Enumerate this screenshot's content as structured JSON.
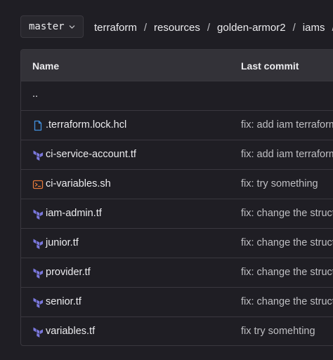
{
  "branch": {
    "label": "master"
  },
  "breadcrumb": [
    "terraform",
    "resources",
    "golden-armor2",
    "iams"
  ],
  "breadcrumb_sep": "/",
  "table": {
    "headers": {
      "name": "Name",
      "last_commit": "Last commit"
    },
    "parent": "..",
    "rows": [
      {
        "name": ".terraform.lock.hcl",
        "icon": "file-icon",
        "commit": "fix: add iam terraform"
      },
      {
        "name": "ci-service-account.tf",
        "icon": "terraform-icon",
        "commit": "fix: add iam terraform"
      },
      {
        "name": "ci-variables.sh",
        "icon": "terminal-icon",
        "commit": "fix: try something"
      },
      {
        "name": "iam-admin.tf",
        "icon": "terraform-icon",
        "commit": "fix: change the structure"
      },
      {
        "name": "junior.tf",
        "icon": "terraform-icon",
        "commit": "fix: change the structure"
      },
      {
        "name": "provider.tf",
        "icon": "terraform-icon",
        "commit": "fix: change the structure"
      },
      {
        "name": "senior.tf",
        "icon": "terraform-icon",
        "commit": "fix: change the structure"
      },
      {
        "name": "variables.tf",
        "icon": "terraform-icon",
        "commit": "fix try somehting"
      }
    ]
  },
  "colors": {
    "background": "#1f1e24",
    "header_bg": "#333238",
    "border": "#3a383f",
    "file_icon": "#428fdc",
    "terraform_icon": "#7b78de",
    "terminal_icon": "#e2783a"
  }
}
